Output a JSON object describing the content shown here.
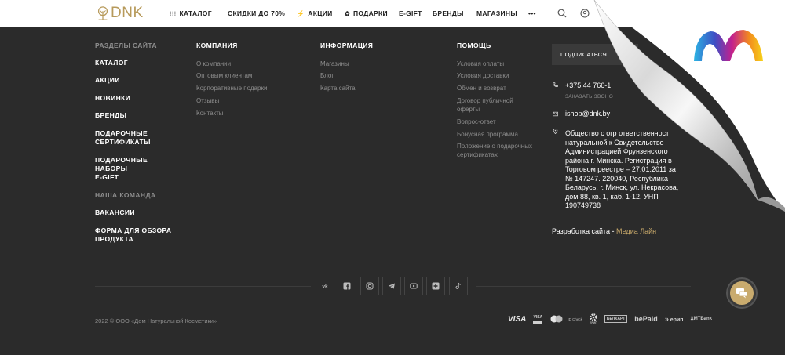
{
  "header": {
    "logo_text": "DNK",
    "nav": [
      {
        "label": "КАТАЛОГ",
        "icon": "grid-icon"
      },
      {
        "label": "СКИДКИ ДО 70%"
      },
      {
        "label": "АКЦИИ",
        "icon": "lightning-icon"
      },
      {
        "label": "ПОДАРКИ",
        "icon": "flower-icon"
      },
      {
        "label": "E-GIFT"
      },
      {
        "label": "БРЕНДЫ"
      },
      {
        "label": "МАГАЗИНЫ"
      },
      {
        "label": "•••"
      }
    ]
  },
  "footer": {
    "sections_title": "РАЗДЕЛЫ САЙТА",
    "sections": [
      "КАТАЛОГ",
      "АКЦИИ",
      "НОВИНКИ",
      "БРЕНДЫ",
      "ПОДАРОЧНЫЕ СЕРТИФИКАТЫ",
      "ПОДАРОЧНЫЕ НАБОРЫ",
      "E-GIFT",
      "НАША КОМАНДА",
      "ВАКАНСИИ",
      "ФОРМА ДЛЯ ОБЗОРА ПРОДУКТА"
    ],
    "company_title": "КОМПАНИЯ",
    "company": [
      "О компании",
      "Оптовым клиентам",
      "Корпоративные подарки",
      "Отзывы",
      "Контакты"
    ],
    "info_title": "ИНФОРМАЦИЯ",
    "info": [
      "Магазины",
      "Блог",
      "Карта сайта"
    ],
    "help_title": "ПОМОЩЬ",
    "help": [
      "Условия оплаты",
      "Условия доставки",
      "Обмен и возврат",
      "Договор публичной оферты",
      "Вопрос-ответ",
      "Бонусная программа",
      "Положение о подарочных сертификатах"
    ],
    "subscribe_label": "ПОДПИСАТЬСЯ",
    "phone": "+375 44 766-1",
    "callback": "ЗАКАЗАТЬ ЗВОНО",
    "email": "ishop@dnk.by",
    "address": "Общество с огр ответственност натуральной к Свидетельство Администрацией Фрунзенского района г. Минска. Регистрация в Торговом реестре – 27.01.2011 за № 147247. 220040, Республика Беларусь, г. Минск, ул. Некрасова, дом 88, кв. 1, каб. 1-12. УНП 190749738",
    "dev_label": "Разработка сайта - ",
    "dev_link": "Медиа Лайн",
    "copyright": "2022 © ООО «Дом Натуральной Косметики»",
    "payments": [
      "VISA",
      "VISA",
      "mastercard",
      "ID Check",
      "ЕРИП",
      "БЕЛКАРТ",
      "bePaid",
      "ерип",
      "МТБank"
    ],
    "social": [
      "vk-icon",
      "facebook-icon",
      "instagram-icon",
      "telegram-icon",
      "youtube-icon",
      "plus-icon",
      "tiktok-icon"
    ]
  },
  "colors": {
    "accent": "#c8a96a",
    "bg": "#2b2b2b"
  }
}
